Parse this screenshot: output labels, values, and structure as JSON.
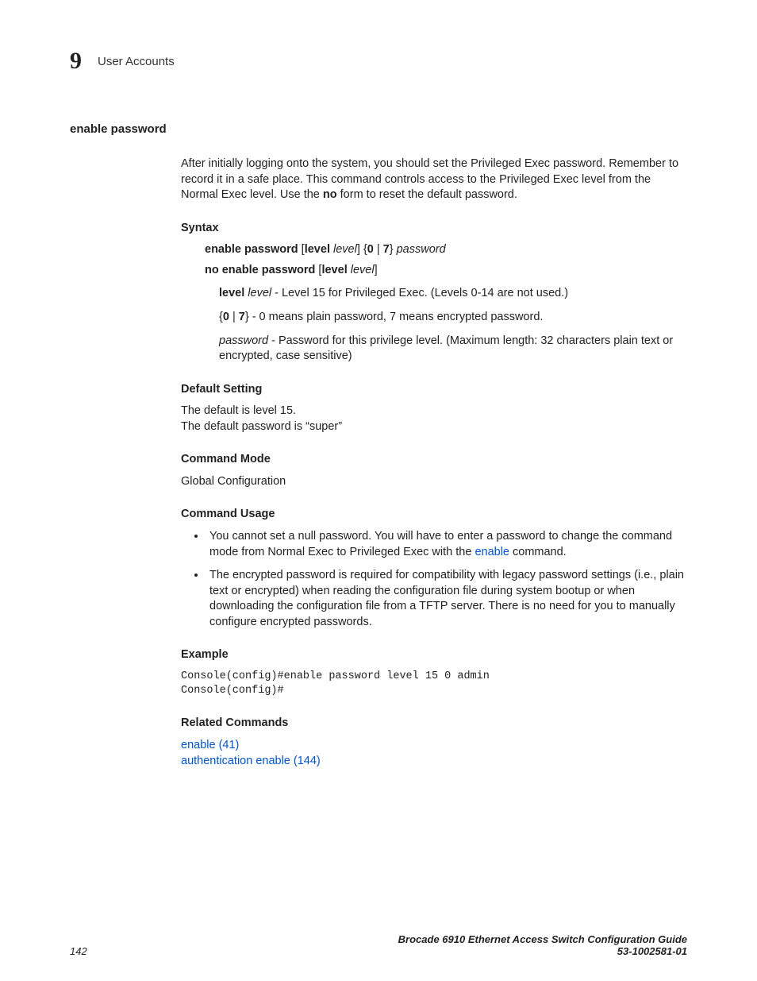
{
  "header": {
    "chapter_number": "9",
    "chapter_title": "User Accounts"
  },
  "section_title": "enable password",
  "intro": {
    "part1": "After initially logging onto the system, you should set the Privileged Exec password. Remember to record it in a safe place. This command controls access to the Privileged Exec level from the Normal Exec level. Use the ",
    "no_bold": "no",
    "part2": " form to reset the default password."
  },
  "syntax": {
    "heading": "Syntax",
    "line1_bold1": "enable password",
    "line1_plain1": " [",
    "line1_bold2": "level",
    "line1_italic1": " level",
    "line1_plain2": "] {",
    "line1_bold3": "0",
    "line1_plain3": " | ",
    "line1_bold4": "7",
    "line1_plain4": "} ",
    "line1_italic2": "password",
    "line2_bold1": "no enable password",
    "line2_plain1": " [",
    "line2_bold2": "level",
    "line2_italic1": " level",
    "line2_plain2": "]",
    "param_level_bold": "level",
    "param_level_italic": " level",
    "param_level_desc": " - Level 15 for Privileged Exec. (Levels 0-14 are not used.)",
    "param_07_plain1": "{",
    "param_07_bold1": "0",
    "param_07_plain2": " | ",
    "param_07_bold2": "7",
    "param_07_plain3": "} - 0 means plain password, 7 means encrypted password.",
    "param_pw_italic": "password",
    "param_pw_desc": " - Password for this privilege level. (Maximum length: 32 characters plain text or encrypted, case sensitive)"
  },
  "default_setting": {
    "heading": "Default Setting",
    "line1": "The default is level 15.",
    "line2": "The default password is “super”"
  },
  "command_mode": {
    "heading": "Command Mode",
    "text": "Global Configuration"
  },
  "command_usage": {
    "heading": "Command Usage",
    "bullet1_pre": "You cannot set a null password. You will have to enter a password to change the command mode from Normal Exec to Privileged Exec with the ",
    "bullet1_link": "enable",
    "bullet1_post": " command.",
    "bullet2": "The encrypted password is required for compatibility with legacy password settings (i.e., plain text or encrypted) when reading the configuration file during system bootup or when downloading the configuration file from a TFTP server. There is no need for you to manually configure encrypted passwords."
  },
  "example": {
    "heading": "Example",
    "code": "Console(config)#enable password level 15 0 admin\nConsole(config)#"
  },
  "related": {
    "heading": "Related Commands",
    "link1": "enable (41)",
    "link2": "authentication enable (144)"
  },
  "footer": {
    "page_num": "142",
    "title": "Brocade 6910 Ethernet Access Switch Configuration Guide",
    "docnum": "53-1002581-01"
  }
}
